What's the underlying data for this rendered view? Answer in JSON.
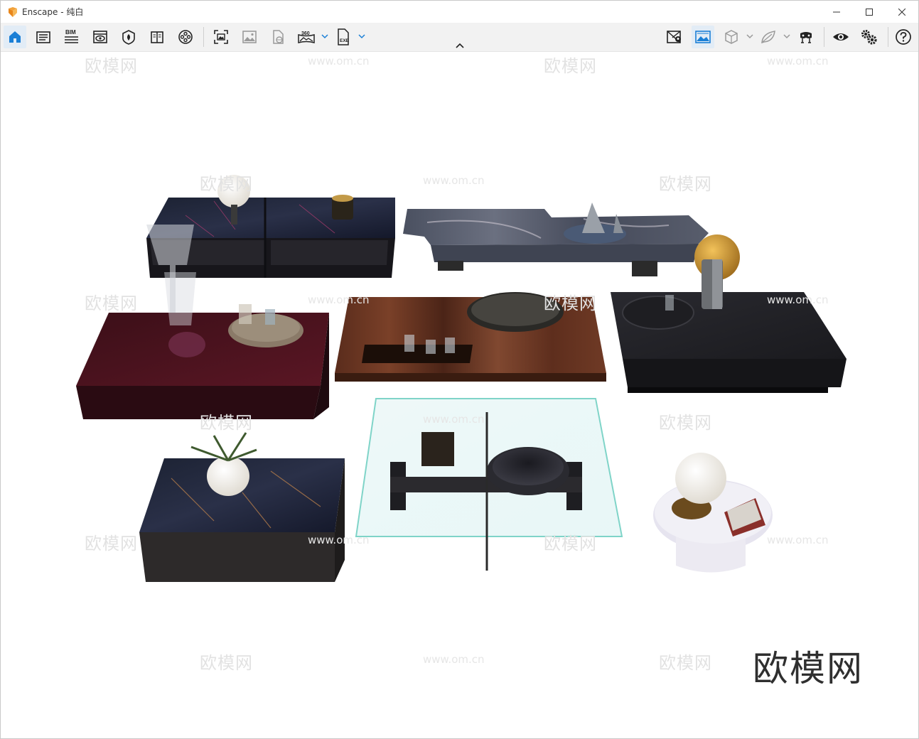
{
  "window": {
    "app_name": "Enscape",
    "separator": " - ",
    "view_name": "纯白"
  },
  "toolbar": {
    "left_tools": [
      {
        "name": "home",
        "icon": "home-icon",
        "active": true
      },
      {
        "name": "views",
        "icon": "document-list-icon"
      },
      {
        "name": "bim",
        "icon": "bim-icon",
        "label": "BIM"
      },
      {
        "name": "visual-settings",
        "icon": "eye-window-icon"
      },
      {
        "name": "asset-library",
        "icon": "leaf-shield-icon"
      },
      {
        "name": "material-editor",
        "icon": "book-icon"
      },
      {
        "name": "video-editor",
        "icon": "film-reel-icon"
      },
      {
        "name": "screenshot",
        "icon": "capture-frame-icon"
      },
      {
        "name": "batch-render",
        "icon": "image-icon"
      },
      {
        "name": "web-standalone",
        "icon": "file-globe-icon"
      },
      {
        "name": "panorama",
        "icon": "panorama-360-icon",
        "label": "360"
      },
      {
        "name": "export-exe",
        "icon": "exe-file-icon",
        "label": "EXE"
      }
    ],
    "right_tools": [
      {
        "name": "sync-views",
        "icon": "map-pin-icon"
      },
      {
        "name": "sync-panorama",
        "icon": "sync-image-icon",
        "active": true
      },
      {
        "name": "orthographic",
        "icon": "cube-icon"
      },
      {
        "name": "capture-leaf",
        "icon": "leaf-icon"
      },
      {
        "name": "vr-headset",
        "icon": "vr-headset-icon"
      },
      {
        "name": "preview",
        "icon": "eye-icon"
      },
      {
        "name": "settings",
        "icon": "gears-icon"
      },
      {
        "name": "help",
        "icon": "help-icon"
      }
    ]
  },
  "watermarks": {
    "text": "欧模网",
    "url": "www.om.cn"
  },
  "brand": "欧模网"
}
